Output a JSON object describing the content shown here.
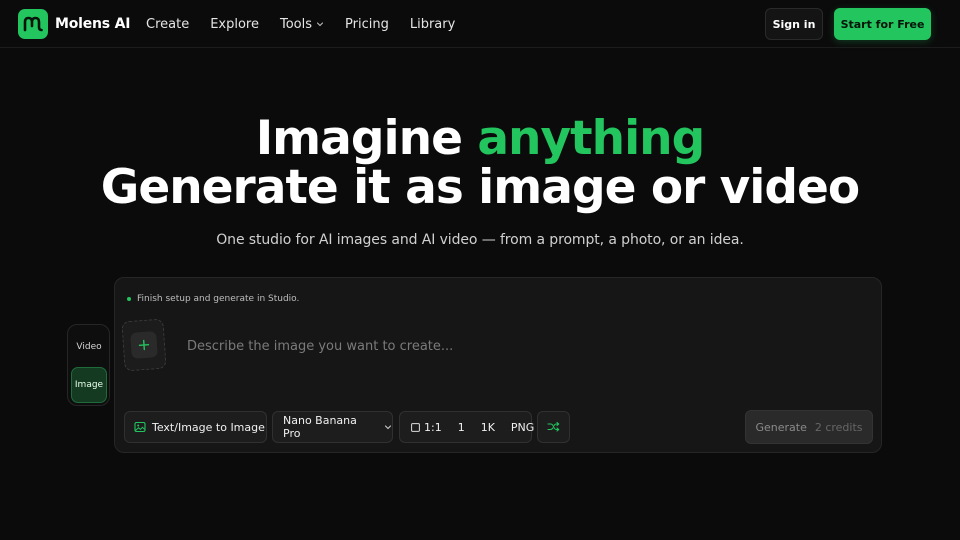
{
  "colors": {
    "accent": "#22c55e",
    "background": "#0b0b0b",
    "panel": "#161616"
  },
  "nav": {
    "brand": "Molens AI",
    "logo_icon": "molens-logo-icon",
    "links": [
      {
        "label": "Create"
      },
      {
        "label": "Explore"
      },
      {
        "label": "Tools",
        "has_dropdown": true
      },
      {
        "label": "Pricing"
      },
      {
        "label": "Library"
      }
    ],
    "sign_in": "Sign in",
    "start": "Start for Free"
  },
  "hero": {
    "line1_prefix": "Imagine ",
    "line1_accent": "anything",
    "line2": "Generate it as image or video",
    "subtitle": "One studio for AI images and AI video — from a prompt, a photo, or an idea."
  },
  "studio": {
    "modes": {
      "video": "Video",
      "image": "Image",
      "selected": "Image"
    },
    "status": "Finish setup and generate in Studio.",
    "prompt_placeholder": "Describe the image you want to create...",
    "prompt_value": "",
    "mode_select": "Text/Image to Image",
    "model_select": "Nano Banana Pro",
    "settings": {
      "ratio": "1:1",
      "count": "1",
      "resolution": "1K",
      "format": "PNG"
    },
    "generate_label": "Generate",
    "generate_credits": "2 credits",
    "icons": [
      "image-icon",
      "chevron-down-icon",
      "square-icon",
      "shuffle-icon",
      "plus-icon"
    ]
  }
}
